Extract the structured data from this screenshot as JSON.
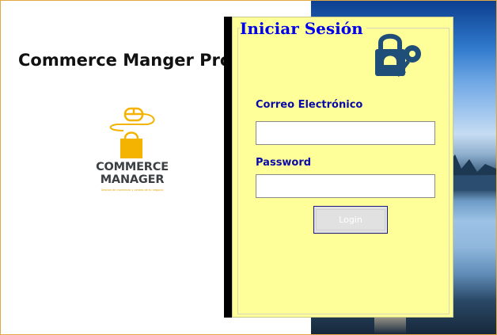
{
  "app": {
    "title": "Commerce Manger Pro"
  },
  "logo": {
    "line1": "COMMERCE",
    "line2": "MANAGER",
    "tagline": "Gestion de inventario y ventas de tu negocio",
    "color_primary": "#f5b301",
    "color_text": "#3c4043"
  },
  "login": {
    "title": "Iniciar Sesión",
    "email_label": "Correo Electrónico",
    "email_value": "",
    "password_label": "Password",
    "password_value": "",
    "button_label": "Login",
    "icon": "lock-key-icon",
    "panel_color": "#ffff99",
    "accent_color": "#0a0aa8"
  }
}
